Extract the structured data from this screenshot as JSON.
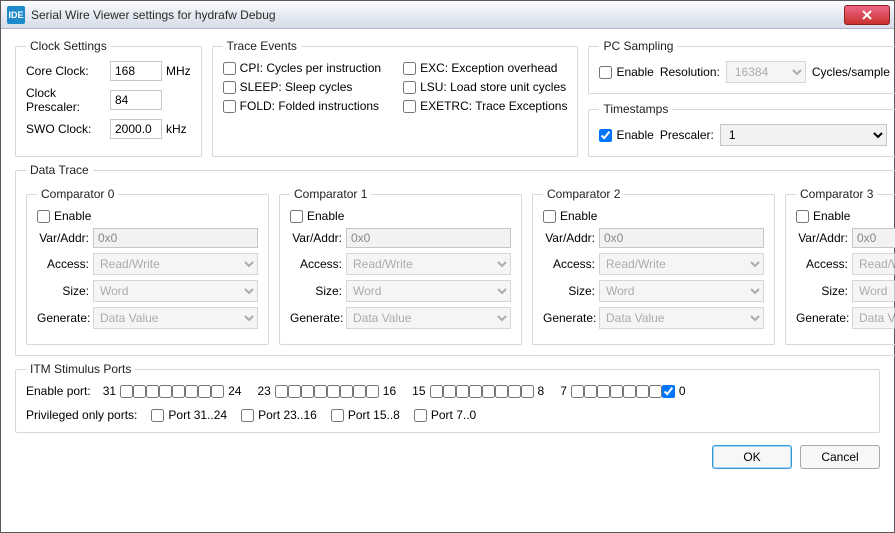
{
  "window": {
    "title": "Serial Wire Viewer settings for hydrafw Debug"
  },
  "clock": {
    "legend": "Clock Settings",
    "core_label": "Core Clock:",
    "core_value": "168",
    "core_unit": "MHz",
    "pre_label": "Clock Prescaler:",
    "pre_value": "84",
    "swo_label": "SWO Clock:",
    "swo_value": "2000.0",
    "swo_unit": "kHz"
  },
  "trace": {
    "legend": "Trace Events",
    "cpi": "CPI: Cycles per instruction",
    "sleep": "SLEEP: Sleep cycles",
    "fold": "FOLD: Folded instructions",
    "exc": "EXC: Exception overhead",
    "lsu": "LSU: Load store unit cycles",
    "exetrc": "EXETRC: Trace Exceptions"
  },
  "pc": {
    "legend": "PC Sampling",
    "enable": "Enable",
    "res_label": "Resolution:",
    "res_value": "16384",
    "unit": "Cycles/sample"
  },
  "ts": {
    "legend": "Timestamps",
    "enable": "Enable",
    "pre_label": "Prescaler:",
    "pre_value": "1"
  },
  "datatrace": {
    "legend": "Data Trace",
    "enable": "Enable",
    "var_label": "Var/Addr:",
    "access_label": "Access:",
    "size_label": "Size:",
    "gen_label": "Generate:",
    "var_value": "0x0",
    "access_value": "Read/Write",
    "size_value": "Word",
    "gen_value": "Data Value",
    "c0": "Comparator 0",
    "c1": "Comparator 1",
    "c2": "Comparator 2",
    "c3": "Comparator 3"
  },
  "itm": {
    "legend": "ITM Stimulus Ports",
    "enable_port": "Enable port:",
    "priv_label": "Privileged only ports:",
    "p3124": "Port 31..24",
    "p2316": "Port 23..16",
    "p158": "Port 15..8",
    "p70": "Port 7..0",
    "g31": "31",
    "g24": "24",
    "g23": "23",
    "g16": "16",
    "g15": "15",
    "g8": "8",
    "g7": "7",
    "g0": "0"
  },
  "buttons": {
    "ok": "OK",
    "cancel": "Cancel"
  }
}
